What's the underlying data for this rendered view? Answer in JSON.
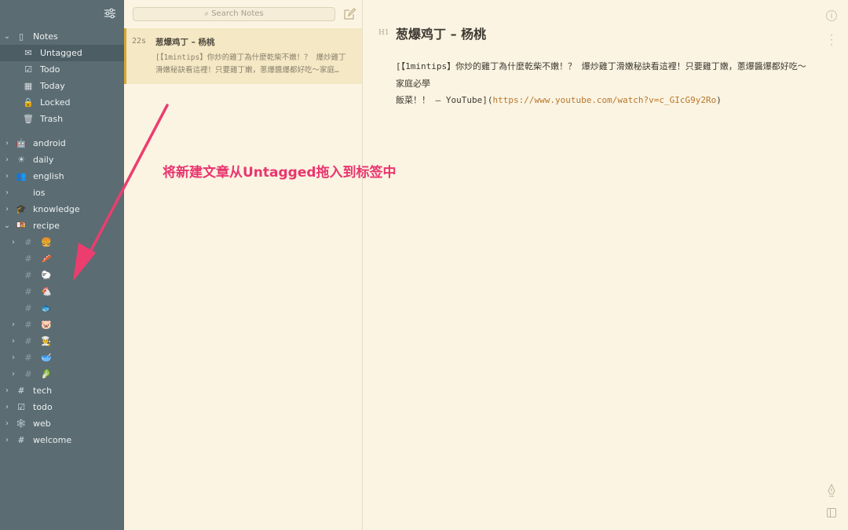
{
  "sidebar": {
    "primary": [
      {
        "chevron": "⌄",
        "icon": "▯",
        "label": "Notes"
      },
      {
        "chevron": "",
        "icon": "✉",
        "label": "Untagged",
        "selected": true
      },
      {
        "chevron": "",
        "icon": "☑",
        "label": "Todo"
      },
      {
        "chevron": "",
        "icon": "▦",
        "label": "Today"
      },
      {
        "chevron": "",
        "icon": "🔒",
        "label": "Locked"
      },
      {
        "chevron": "",
        "icon": "🗑",
        "label": "Trash"
      }
    ],
    "tags": [
      {
        "chevron": "›",
        "icon": "🤖",
        "label": "android"
      },
      {
        "chevron": "›",
        "icon": "☀",
        "label": "daily"
      },
      {
        "chevron": "›",
        "icon": "👥",
        "label": "english"
      },
      {
        "chevron": "›",
        "icon": "",
        "label": "ios"
      },
      {
        "chevron": "›",
        "icon": "🎓",
        "label": "knowledge"
      },
      {
        "chevron": "⌄",
        "icon": "🍱",
        "label": "recipe"
      }
    ],
    "recipe_children": [
      {
        "chevron": "›",
        "emoji": "🍔"
      },
      {
        "chevron": "",
        "emoji": "🥓"
      },
      {
        "chevron": "",
        "emoji": "🐑"
      },
      {
        "chevron": "",
        "emoji": "🐔"
      },
      {
        "chevron": "",
        "emoji": "🐟"
      },
      {
        "chevron": "›",
        "emoji": "🐷"
      },
      {
        "chevron": "›",
        "emoji": "👨‍🍳"
      },
      {
        "chevron": "›",
        "emoji": "🥣"
      },
      {
        "chevron": "›",
        "emoji": "🥬"
      }
    ],
    "tags_after": [
      {
        "chevron": "›",
        "icon": "#",
        "label": "tech"
      },
      {
        "chevron": "›",
        "icon": "☑",
        "label": "todo"
      },
      {
        "chevron": "›",
        "icon": "🕸",
        "label": "web"
      },
      {
        "chevron": "›",
        "icon": "#",
        "label": "welcome"
      }
    ]
  },
  "notelist": {
    "search_placeholder": "Search Notes",
    "notes": [
      {
        "age": "22s",
        "title": "葱爆鸡丁 – 杨桃",
        "snippet_line1": "[【1mintips】你炒的雞丁為什麼乾柴不嫩！？ 爆炒雞丁",
        "snippet_line2": "滑嫩秘訣看這裡！只要雞丁嫩，蔥爆醬爆都好吃～家庭…"
      }
    ]
  },
  "editor": {
    "heading_marker": "H1",
    "title": "葱爆鸡丁 – 杨桃",
    "body_line1": "[【1mintips】你炒的雞丁為什麼乾柴不嫩！？ 爆炒雞丁滑嫩秘訣看這裡！只要雞丁嫩，蔥爆醬爆都好吃～",
    "body_line2": "家庭必學",
    "body_line3_prefix": "飯菜！！ – YouTube](",
    "body_line3_url": "https://www.youtube.com/watch?v=c_GIcG9y2Ro",
    "body_line3_suffix": ")"
  },
  "annotation": {
    "text": "将新建文章从Untagged拖入到标签中"
  },
  "colors": {
    "sidebar_bg": "#5b6c73",
    "paper_bg": "#fbf4e2",
    "selected_card": "#f4e8c5",
    "accent": "#d9a737",
    "link": "#b9772c",
    "annotation": "#e9356f"
  }
}
